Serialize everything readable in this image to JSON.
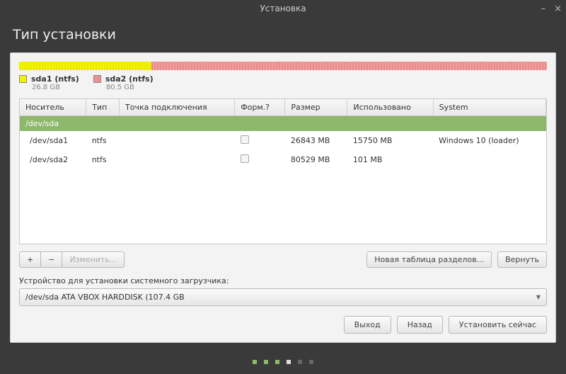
{
  "window": {
    "title": "Установка"
  },
  "header": {
    "title": "Тип установки"
  },
  "partitions_bar": {
    "items": [
      {
        "label": "sda1 (ntfs)",
        "size": "26.8 GB",
        "color": "#f2f200",
        "pct": 25
      },
      {
        "label": "sda2 (ntfs)",
        "size": "80.5 GB",
        "color": "#f09090",
        "pct": 75
      }
    ]
  },
  "table": {
    "headers": [
      "Носитель",
      "Тип",
      "Точка подключения",
      "Форм.?",
      "Размер",
      "Использовано",
      "System"
    ],
    "device_row": "/dev/sda",
    "rows": [
      {
        "dev": "/dev/sda1",
        "type": "ntfs",
        "mount": "",
        "format": false,
        "size": "26843 MB",
        "used": "15750 MB",
        "system": "Windows 10 (loader)"
      },
      {
        "dev": "/dev/sda2",
        "type": "ntfs",
        "mount": "",
        "format": false,
        "size": "80529 MB",
        "used": "101 MB",
        "system": ""
      }
    ]
  },
  "toolbar": {
    "add": "+",
    "remove": "−",
    "change": "Изменить...",
    "new_table": "Новая таблица разделов...",
    "revert": "Вернуть"
  },
  "bootloader": {
    "label": "Устройство для установки системного загрузчика:",
    "value": "/dev/sda   ATA VBOX HARDDISK (107.4 GB"
  },
  "footer": {
    "quit": "Выход",
    "back": "Назад",
    "install": "Установить сейчас"
  },
  "progress": {
    "total": 6,
    "current": 3
  }
}
